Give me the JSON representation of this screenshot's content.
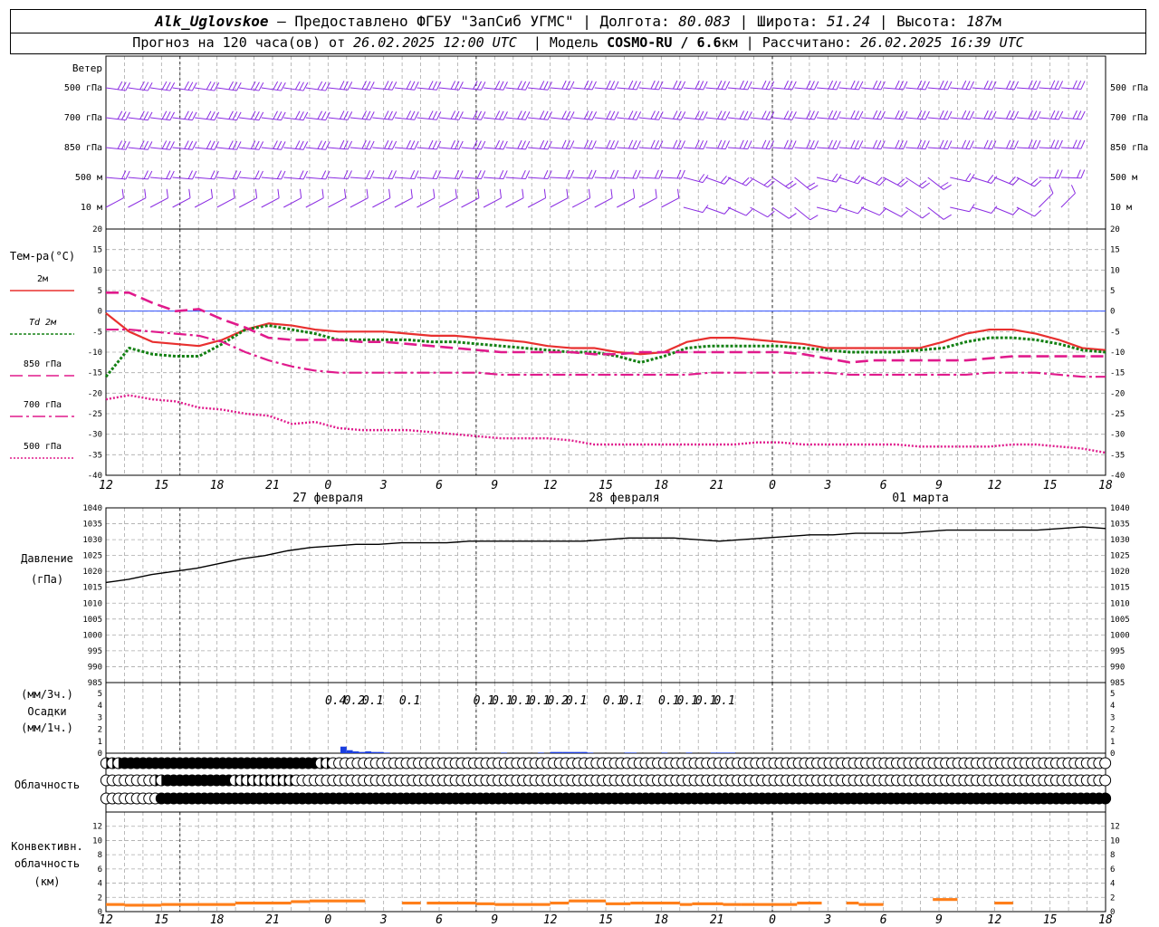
{
  "header": {
    "station": "Alk_Uglovskoe",
    "provider": "— Предоставлено ФГБУ \"ЗапСиб УГМС\"",
    "lon_label": "Долгота:",
    "lon": "80.083",
    "lat_label": "Широта:",
    "lat": "51.24",
    "alt_label": "Высота:",
    "alt": "187",
    "alt_unit": "м",
    "forecast_label": "Прогноз на 120 часа(ов) от",
    "forecast_time": "26.02.2025 12:00 UTC",
    "model_label": "Модель",
    "model": "COSMO-RU / 6.6",
    "model_unit": "км",
    "computed_label": "Рассчитано:",
    "computed_time": "26.02.2025 16:39 UTC"
  },
  "labels": {
    "wind": "Ветер",
    "temp": "Тем-ра(°C)",
    "pressure": "Давление",
    "pressure_unit": "(гПа)",
    "precip_top": "(мм/3ч.)",
    "precip": "Осадки",
    "precip_bottom": "(мм/1ч.)",
    "cloud": "Облачность",
    "conv1": "Конвективн.",
    "conv2": "облачность",
    "conv3": "(км)"
  },
  "colors": {
    "t2m": "#e8302f",
    "td": "#138013",
    "t850": "#e01a8c",
    "t700": "#e01a8c",
    "t500": "#e01a8c",
    "wind": "#8a2be2",
    "precip": "#1a3ee0",
    "conv": "#ff7f1a",
    "zero": "#3050ff"
  },
  "chart_data": [
    {
      "type": "wind-barbs",
      "levels": [
        "500 гПа",
        "700 гПа",
        "850 гПа",
        "500 м",
        "10 м"
      ]
    },
    {
      "type": "line",
      "x_ticks": [
        "12",
        "15",
        "18",
        "21",
        "0",
        "3",
        "6",
        "9",
        "12",
        "15",
        "18",
        "21",
        "0",
        "3",
        "6",
        "9",
        "12",
        "15",
        "18"
      ],
      "day_labels": [
        "27 февраля",
        "28 февраля",
        "01 марта"
      ],
      "ylim": [
        -40,
        20
      ],
      "yticks": [
        -40,
        -35,
        -30,
        -25,
        -20,
        -15,
        -10,
        -5,
        0,
        5,
        10,
        15,
        20
      ],
      "series": [
        {
          "name": "2м",
          "style": "solid",
          "values": [
            -0.5,
            -5,
            -7.5,
            -8,
            -8.5,
            -7,
            -4.5,
            -3,
            -3.5,
            -4.5,
            -5,
            -5,
            -5,
            -5.5,
            -6,
            -6,
            -6.5,
            -7,
            -7.5,
            -8.5,
            -9,
            -9,
            -10,
            -10.5,
            -10,
            -7.5,
            -6.5,
            -6.5,
            -7,
            -7.5,
            -8,
            -9,
            -9,
            -9,
            -9,
            -9,
            -7.5,
            -5.5,
            -4.5,
            -4.5,
            -5.5,
            -7,
            -9,
            -9.5
          ]
        },
        {
          "name": "Td 2м",
          "style": "dotted",
          "values": [
            -16,
            -9,
            -10.5,
            -11,
            -11,
            -8,
            -4.5,
            -3.5,
            -4.5,
            -5.5,
            -7,
            -7,
            -7,
            -7,
            -7.5,
            -7.5,
            -8,
            -8.5,
            -9,
            -9.5,
            -10,
            -10,
            -11,
            -12.5,
            -11,
            -9,
            -8.5,
            -8.5,
            -8.5,
            -8.5,
            -9,
            -9.5,
            -10,
            -10,
            -10,
            -9.5,
            -9,
            -7.5,
            -6.5,
            -6.5,
            -7,
            -8,
            -9.5,
            -10
          ]
        },
        {
          "name": "850 гПа",
          "style": "dash",
          "values": [
            4.5,
            4.5,
            2,
            0,
            0.5,
            -2,
            -4,
            -6.5,
            -7,
            -7,
            -7,
            -7.5,
            -7.5,
            -8,
            -8.5,
            -9,
            -9.5,
            -10,
            -10,
            -10,
            -10,
            -10.5,
            -10.5,
            -10,
            -10,
            -10,
            -10,
            -10,
            -10,
            -10,
            -10.5,
            -11.5,
            -12.5,
            -12,
            -12,
            -12,
            -12,
            -12,
            -11.5,
            -11,
            -11,
            -11,
            -11,
            -11
          ]
        },
        {
          "name": "700 гПа",
          "style": "dashdot",
          "values": [
            -4.5,
            -4.5,
            -5,
            -5.5,
            -6,
            -7.5,
            -10,
            -12,
            -13.5,
            -14.5,
            -15,
            -15,
            -15,
            -15,
            -15,
            -15,
            -15,
            -15.5,
            -15.5,
            -15.5,
            -15.5,
            -15.5,
            -15.5,
            -15.5,
            -15.5,
            -15.5,
            -15,
            -15,
            -15,
            -15,
            -15,
            -15,
            -15.5,
            -15.5,
            -15.5,
            -15.5,
            -15.5,
            -15.5,
            -15,
            -15,
            -15,
            -15.5,
            -16,
            -16
          ]
        },
        {
          "name": "500 гПа",
          "style": "dotted",
          "values": [
            -21.5,
            -20.5,
            -21.5,
            -22,
            -23.5,
            -24,
            -25,
            -25.5,
            -27.5,
            -27,
            -28.5,
            -29,
            -29,
            -29,
            -29.5,
            -30,
            -30.5,
            -31,
            -31,
            -31,
            -31.5,
            -32.5,
            -32.5,
            -32.5,
            -32.5,
            -32.5,
            -32.5,
            -32.5,
            -32,
            -32,
            -32.5,
            -32.5,
            -32.5,
            -32.5,
            -32.5,
            -33,
            -33,
            -33,
            -33,
            -32.5,
            -32.5,
            -33,
            -33.5,
            -34.5
          ]
        }
      ]
    },
    {
      "type": "line",
      "ylabel": "Давление (гПа)",
      "ylim": [
        985,
        1040
      ],
      "yticks": [
        985,
        990,
        995,
        1000,
        1005,
        1010,
        1015,
        1020,
        1025,
        1030,
        1035,
        1040
      ],
      "series": [
        {
          "name": "",
          "values": [
            1016.5,
            1017.5,
            1019,
            1020,
            1021,
            1022.5,
            1024,
            1025,
            1026.5,
            1027.5,
            1028,
            1028.5,
            1028.5,
            1029,
            1029,
            1029,
            1029.5,
            1029.5,
            1029.5,
            1029.5,
            1029.5,
            1029.5,
            1030,
            1030.5,
            1030.5,
            1030.5,
            1030,
            1029.5,
            1030,
            1030.5,
            1031,
            1031.5,
            1031.5,
            1032,
            1032,
            1032,
            1032.5,
            1033,
            1033,
            1033,
            1033,
            1033,
            1033.5,
            1034,
            1033.5
          ]
        }
      ]
    },
    {
      "type": "bar",
      "ylim": [
        0,
        5
      ],
      "yticks": [
        0,
        1,
        2,
        3,
        4,
        5
      ],
      "labels_3h": [
        {
          "t": 51,
          "text": "0.4"
        },
        {
          "t": 54,
          "text": "0.2"
        },
        {
          "t": 57,
          "text": "0.1"
        },
        {
          "t": 63,
          "text": "0.1"
        },
        {
          "t": 75,
          "text": "0.1"
        },
        {
          "t": 78,
          "text": "0.1"
        },
        {
          "t": 81,
          "text": "0.1"
        },
        {
          "t": 84,
          "text": "0.1"
        },
        {
          "t": 87,
          "text": "0.2"
        },
        {
          "t": 90,
          "text": "0.1"
        },
        {
          "t": 96,
          "text": "0.1"
        },
        {
          "t": 99,
          "text": "0.1"
        },
        {
          "t": 105,
          "text": "0.1"
        },
        {
          "t": 108,
          "text": "0.1"
        },
        {
          "t": 111,
          "text": "0.1"
        },
        {
          "t": 114,
          "text": "0.1"
        }
      ],
      "hourly": [
        {
          "t": 50,
          "v": 0.55
        },
        {
          "t": 51,
          "v": 0.25
        },
        {
          "t": 52,
          "v": 0.15
        },
        {
          "t": 53,
          "v": 0.1
        },
        {
          "t": 54,
          "v": 0.15
        },
        {
          "t": 55,
          "v": 0.1
        },
        {
          "t": 56,
          "v": 0.1
        },
        {
          "t": 57,
          "v": 0.05
        },
        {
          "t": 76,
          "v": 0.05
        },
        {
          "t": 82,
          "v": 0.05
        },
        {
          "t": 84,
          "v": 0.1
        },
        {
          "t": 85,
          "v": 0.1
        },
        {
          "t": 86,
          "v": 0.1
        },
        {
          "t": 87,
          "v": 0.1
        },
        {
          "t": 88,
          "v": 0.1
        },
        {
          "t": 89,
          "v": 0.1
        },
        {
          "t": 90,
          "v": 0.05
        },
        {
          "t": 96,
          "v": 0.05
        },
        {
          "t": 97,
          "v": 0.05
        },
        {
          "t": 102,
          "v": 0.05
        },
        {
          "t": 106,
          "v": 0.05
        },
        {
          "t": 110,
          "v": 0.05
        },
        {
          "t": 111,
          "v": 0.05
        },
        {
          "t": 112,
          "v": 0.05
        },
        {
          "t": 113,
          "v": 0.05
        }
      ]
    },
    {
      "type": "cloud-cover",
      "rows": [
        [
          2,
          2,
          2,
          4,
          4,
          4,
          4,
          4,
          4,
          4,
          4,
          4,
          4,
          4,
          4,
          4,
          4,
          4,
          4,
          4,
          4,
          4,
          4,
          4,
          4,
          4,
          4,
          4,
          4,
          4,
          4,
          4,
          4,
          4,
          4,
          2,
          2,
          1,
          1,
          1,
          1,
          1,
          1,
          1,
          1,
          1,
          1,
          1,
          1,
          1,
          1,
          1,
          1,
          1,
          1,
          1,
          1,
          1,
          1,
          1,
          1,
          1,
          1,
          1,
          1,
          1,
          1,
          1,
          1,
          1,
          1,
          1,
          1,
          1,
          1,
          1,
          1,
          1,
          1,
          1,
          1,
          1,
          1,
          1,
          1,
          1,
          1,
          1,
          1,
          1,
          1,
          1,
          1,
          1,
          1,
          1,
          1,
          1,
          1,
          1,
          1,
          1,
          1,
          1,
          1,
          1,
          1,
          1,
          1,
          1,
          1,
          1,
          1,
          1,
          1,
          1,
          1,
          1,
          1,
          1,
          1,
          1,
          1,
          1,
          1,
          1,
          1,
          1,
          1,
          1,
          1,
          1,
          1,
          1,
          1,
          1,
          1,
          1,
          1,
          1,
          1,
          1,
          1,
          1,
          1,
          1,
          1,
          1,
          1,
          1,
          1,
          1,
          1,
          1,
          1,
          1,
          1,
          1,
          1,
          1,
          1,
          1,
          1,
          1
        ],
        [
          0,
          0,
          0,
          0,
          1,
          1,
          1,
          1,
          2,
          2,
          4,
          4,
          4,
          4,
          4,
          4,
          4,
          4,
          4,
          4,
          4,
          2,
          2,
          2,
          2,
          2,
          2,
          2,
          2,
          2,
          2,
          1,
          1,
          1,
          1,
          1,
          1,
          1,
          1,
          1,
          1,
          1,
          1,
          1,
          1,
          1,
          1,
          1,
          1,
          1,
          1,
          1,
          1,
          1,
          1,
          1,
          1,
          1,
          1,
          1,
          1,
          1,
          1,
          1,
          1,
          1,
          1,
          1,
          1,
          1,
          1,
          1,
          1,
          1,
          1,
          1,
          1,
          1,
          1,
          1,
          1,
          1,
          1,
          1,
          1,
          1,
          1,
          1,
          1,
          1,
          1,
          1,
          1,
          1,
          1,
          1,
          1,
          1,
          1,
          1,
          1,
          1,
          1,
          1,
          1,
          1,
          1,
          1,
          1,
          1,
          1,
          1,
          1,
          1,
          1,
          1,
          1,
          1,
          1,
          1,
          1,
          1,
          1,
          1,
          1,
          1,
          1,
          1,
          1,
          1,
          1,
          1,
          1,
          1,
          1,
          1,
          1,
          1,
          1,
          1,
          1,
          1,
          1,
          1,
          1,
          1,
          1,
          1,
          1,
          1,
          1,
          1,
          1,
          1,
          1,
          1,
          1,
          1,
          1,
          1,
          1,
          1,
          1,
          1
        ],
        [
          0,
          0,
          0,
          0,
          0,
          0,
          0,
          0,
          0,
          4,
          4,
          4,
          4,
          4,
          4,
          4,
          4,
          4,
          4,
          4,
          4,
          4,
          4,
          4,
          4,
          4,
          4,
          4,
          4,
          4,
          4,
          4,
          4,
          4,
          4,
          4,
          4,
          4,
          4,
          4,
          4,
          4,
          4,
          4,
          4,
          4,
          4,
          4,
          4,
          4,
          4,
          4,
          4,
          4,
          4,
          4,
          4,
          4,
          4,
          4,
          4,
          4,
          4,
          4,
          4,
          4,
          4,
          4,
          4,
          4,
          4,
          4,
          4,
          4,
          4,
          4,
          4,
          4,
          4,
          4,
          4,
          4,
          4,
          4,
          4,
          4,
          4,
          4,
          4,
          4,
          4,
          4,
          4,
          4,
          4,
          4,
          4,
          4,
          4,
          4,
          4,
          4,
          4,
          4,
          4,
          4,
          4,
          4,
          4,
          4,
          4,
          4,
          4,
          4,
          4,
          4,
          4,
          4,
          4,
          4,
          4,
          4,
          4,
          4,
          4,
          4,
          4,
          4,
          4,
          4,
          4,
          4,
          4,
          4,
          4,
          4,
          4,
          4,
          4,
          4,
          4,
          4,
          4,
          4,
          4,
          4,
          4,
          4,
          4,
          4,
          4,
          4,
          4,
          4,
          4,
          4,
          4,
          4,
          4,
          4,
          4,
          4,
          4,
          4
        ]
      ]
    },
    {
      "type": "bar",
      "ylim": [
        0,
        14
      ],
      "yticks": [
        0,
        2,
        4,
        6,
        8,
        10,
        12
      ],
      "segments": [
        {
          "t0": 9,
          "t1": 12,
          "v": 0.8
        },
        {
          "t0": 12,
          "t1": 18,
          "v": 0.7
        },
        {
          "t0": 18,
          "t1": 30,
          "v": 0.8
        },
        {
          "t0": 30,
          "t1": 39,
          "v": 1.0
        },
        {
          "t0": 39,
          "t1": 42,
          "v": 1.2
        },
        {
          "t0": 42,
          "t1": 51,
          "v": 1.3
        },
        {
          "t0": 57,
          "t1": 60,
          "v": 1.0
        },
        {
          "t0": 61,
          "t1": 69,
          "v": 1.0
        },
        {
          "t0": 69,
          "t1": 72,
          "v": 0.9
        },
        {
          "t0": 72,
          "t1": 81,
          "v": 0.8
        },
        {
          "t0": 81,
          "t1": 84,
          "v": 1.0
        },
        {
          "t0": 84,
          "t1": 87,
          "v": 1.3
        },
        {
          "t0": 87,
          "t1": 90,
          "v": 1.3
        },
        {
          "t0": 90,
          "t1": 94,
          "v": 0.9
        },
        {
          "t0": 94,
          "t1": 102,
          "v": 1.0
        },
        {
          "t0": 102,
          "t1": 104,
          "v": 0.8
        },
        {
          "t0": 104,
          "t1": 109,
          "v": 0.9
        },
        {
          "t0": 109,
          "t1": 112,
          "v": 0.8
        },
        {
          "t0": 112,
          "t1": 117,
          "v": 0.8
        },
        {
          "t0": 117,
          "t1": 121,
          "v": 0.8
        },
        {
          "t0": 121,
          "t1": 125,
          "v": 1.0
        },
        {
          "t0": 129,
          "t1": 131,
          "v": 1.0
        },
        {
          "t0": 131,
          "t1": 135,
          "v": 0.8
        },
        {
          "t0": 143,
          "t1": 147,
          "v": 1.5
        },
        {
          "t0": 153,
          "t1": 156,
          "v": 1.0
        }
      ]
    }
  ]
}
